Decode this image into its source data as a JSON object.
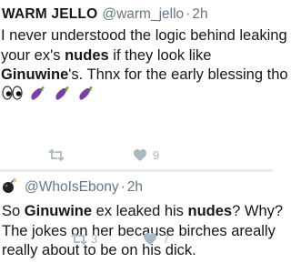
{
  "tweets": [
    {
      "display_name": "WARM JELLO",
      "handle": "@warm_jello",
      "separator": "·",
      "time": "2h",
      "lines": [
        [
          "I never understood the logic behind leaking"
        ],
        [
          "your ex's ",
          {
            "b": "nudes"
          },
          " if they look like"
        ],
        [
          {
            "b": "Ginuwine"
          },
          "'s. Thnx for the early blessing tho"
        ]
      ],
      "emojis": [
        "eyes-icon",
        "eggplant-icon",
        "eggplant-icon",
        "eggplant-icon"
      ],
      "retweet_count": "",
      "like_count": "9"
    },
    {
      "avatar_icon": "bomb-icon",
      "display_name": "",
      "handle": "@WhoIsEbony",
      "separator": "·",
      "time": "2h",
      "lines": [
        [
          "So ",
          {
            "b": "Ginuwine"
          },
          " ex leaked his ",
          {
            "b": "nudes"
          },
          "? Why?"
        ],
        [
          "The jokes on her because birches areally"
        ],
        [
          "really about to be on his dick."
        ]
      ],
      "retweet_count": "3",
      "like_count": "7"
    }
  ],
  "colors": {
    "text": "#14171a",
    "muted": "#657786",
    "action_icon": "#aab8c2",
    "divider": "#e6ecf0",
    "eggplant": "#7b3fa0"
  }
}
